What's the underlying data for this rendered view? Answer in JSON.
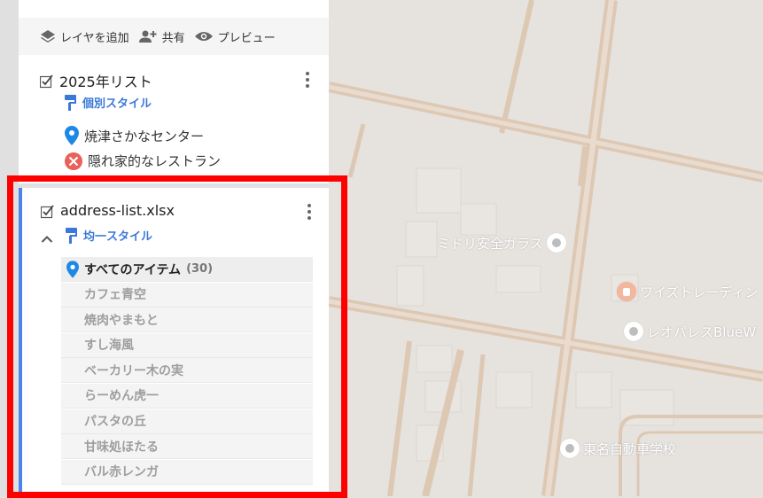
{
  "toolbar": {
    "add_layer_label": "レイヤを追加",
    "share_label": "共有",
    "preview_label": "プレビュー"
  },
  "layer1": {
    "title": "2025年リスト",
    "style_label": "個別スタイル",
    "features": [
      {
        "name": "焼津さかなセンター",
        "icon": "blue-pin-icon",
        "color": "#1e88e5"
      },
      {
        "name": "隠れ家的なレストラン",
        "icon": "restaurant-icon",
        "color": "#e8615a"
      }
    ]
  },
  "layer2": {
    "title": "address-list.xlsx",
    "style_label": "均一スタイル",
    "all_items_label": "すべてのアイテム",
    "all_items_count": "(30)",
    "items": [
      "カフェ青空",
      "焼肉やまもと",
      "すし海風",
      "ベーカリー木の実",
      "らーめん虎一",
      "パスタの丘",
      "甘味処ほたる",
      "バル赤レンガ"
    ]
  },
  "map": {
    "pois": [
      "ミドリ安全ガラス",
      "ワイズトレーディン",
      "レオパレスBlueW",
      "東名自動車学校"
    ],
    "edge_labels": [
      "保",
      "町"
    ]
  },
  "colors": {
    "accent": "#4a86e8",
    "link": "#3b78d8",
    "highlight": "#ff0000",
    "road": "#d9c3ad",
    "map_bg": "#e6e3df"
  }
}
